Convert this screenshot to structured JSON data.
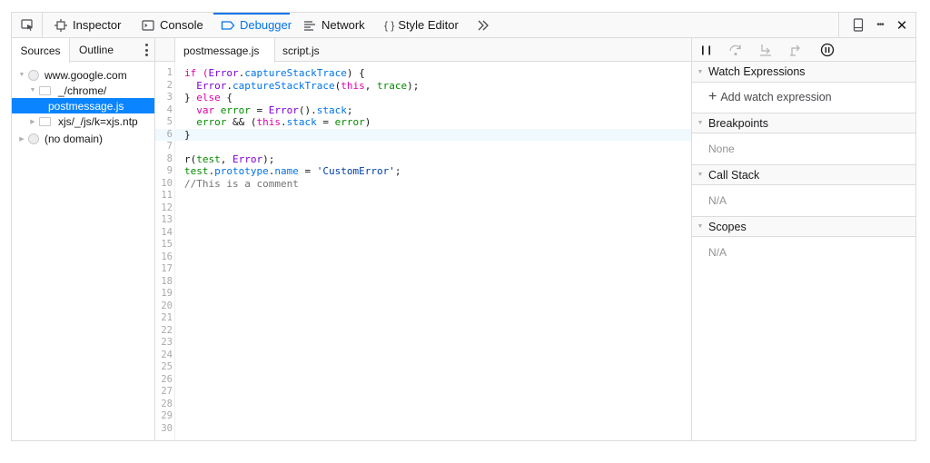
{
  "toolbar": {
    "tabs": [
      {
        "label": "Inspector",
        "icon": "inspector-icon"
      },
      {
        "label": "Console",
        "icon": "console-icon"
      },
      {
        "label": "Debugger",
        "icon": "debugger-icon"
      },
      {
        "label": "Network",
        "icon": "network-icon"
      },
      {
        "label": "Style Editor",
        "icon_text": "{ }"
      }
    ],
    "selected_tab": "Debugger",
    "overflow_icon": "chevron-double-right-icon",
    "right_icons": [
      "responsive-design-icon",
      "more-options-icon",
      "close-icon"
    ],
    "more_glyph": "•••",
    "close_glyph": "✕"
  },
  "sources_panel": {
    "tabs": [
      "Sources",
      "Outline"
    ],
    "active_tab": "Sources",
    "tree": [
      {
        "label": "www.google.com",
        "type": "domain"
      },
      {
        "label": "_/chrome/",
        "type": "folder"
      },
      {
        "label": "postmessage.js",
        "type": "file",
        "selected": true
      },
      {
        "label": "xjs/_/js/k=xjs.ntp",
        "type": "folder"
      },
      {
        "label": "(no domain)",
        "type": "domain"
      }
    ]
  },
  "editor": {
    "tabs": [
      "postmessage.js",
      "script.js"
    ],
    "active_tab": "postmessage.js",
    "current_line": 6,
    "line_count": 30,
    "lines": {
      "l1": [
        "if (",
        "Error",
        ".",
        "captureStackTrace",
        ") {"
      ],
      "l2": [
        "  ",
        "Error",
        ".",
        "captureStackTrace",
        "(",
        "this",
        ", ",
        "trace",
        ");"
      ],
      "l3": [
        "} ",
        "else",
        " {"
      ],
      "l4": [
        "  ",
        "var",
        " ",
        "error",
        " = ",
        "Error",
        "().",
        "stack",
        ";"
      ],
      "l5": [
        "  ",
        "error",
        " && (",
        "this",
        ".",
        "stack",
        " = ",
        "error",
        ")"
      ],
      "l6": [
        "}"
      ],
      "l8": [
        "r",
        "(",
        "test",
        ", ",
        "Error",
        ");"
      ],
      "l9": [
        "test",
        ".",
        "prototype",
        ".",
        "name",
        " = ",
        "'CustomError'",
        ";"
      ],
      "l10": [
        "//This is a comment"
      ]
    }
  },
  "debugger_panel": {
    "controls": [
      "pause-icon",
      "step-over-icon",
      "step-in-icon",
      "step-out-icon",
      "pause-on-exceptions-icon"
    ],
    "pause_glyph": "❙❙",
    "sections": [
      {
        "title": "Watch Expressions",
        "action_label": "Add watch expression",
        "plus": "+"
      },
      {
        "title": "Breakpoints",
        "content": "None"
      },
      {
        "title": "Call Stack",
        "content": "N/A"
      },
      {
        "title": "Scopes",
        "content": "N/A"
      }
    ],
    "expand_glyph": "▼"
  }
}
